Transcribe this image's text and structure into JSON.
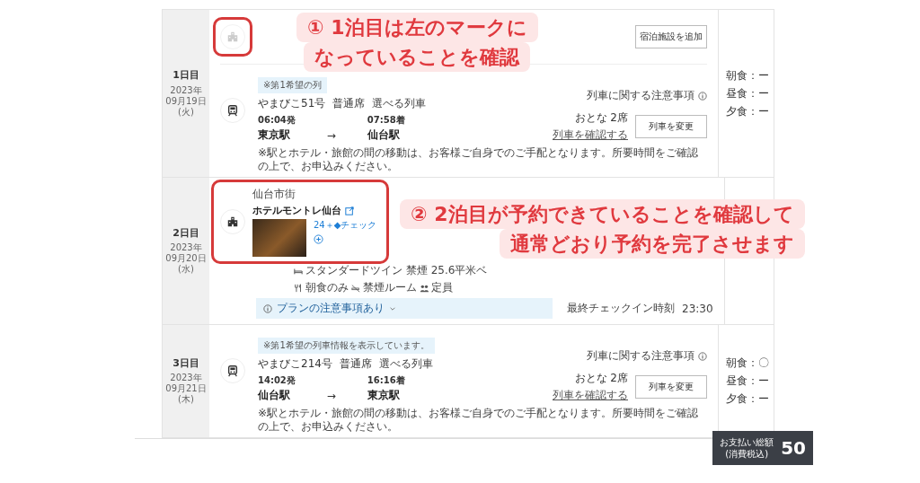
{
  "days": [
    {
      "label": "1日目",
      "year": "2023年",
      "date": "09月19日",
      "weekday": "(火)",
      "stay": {
        "booked": false,
        "button": "宿泊施設を追加",
        "highlighted": true
      },
      "train": {
        "notice": "※第1希望の列",
        "name": "やまびこ51号",
        "seat": "普通席",
        "tag": "選べる列車",
        "dep_time": "06:04発",
        "arr_time": "07:58着",
        "from": "東京駅",
        "arrow": "→",
        "to": "仙台駅",
        "note": "※駅とホテル・旅館の間の移動は、お客様ご自身でのご手配となります。所要時間をご確認の上で、お申込みください。",
        "caution": "列車に関する注意事項",
        "seats": "おとな 2席",
        "check_link": "列車を確認する",
        "change_button": "列車を変更"
      },
      "meals": [
        "朝食：ー",
        "昼食：ー",
        "夕食：ー"
      ]
    },
    {
      "label": "2日目",
      "year": "2023年",
      "date": "09月20日",
      "weekday": "(水)",
      "stay": {
        "booked": true,
        "highlighted": true,
        "area": "仙台市街",
        "name": "ホテルモントレ仙台",
        "plan": "24＋◆チェック",
        "room": "スタンダードツイン 禁煙 25.6平米ベ",
        "meal": "朝食のみ",
        "smoking": "禁煙ルーム",
        "capacity": "定員",
        "plan_notice": "プランの注意事項あり",
        "checkin_label": "最終チェックイン時刻",
        "checkin_time": "23:30"
      }
    },
    {
      "label": "3日目",
      "year": "2023年",
      "date": "09月21日",
      "weekday": "(木)",
      "train": {
        "notice": "※第1希望の列車情報を表示しています。",
        "name": "やまびこ214号",
        "seat": "普通席",
        "tag": "選べる列車",
        "dep_time": "14:02発",
        "arr_time": "16:16着",
        "from": "仙台駅",
        "arrow": "→",
        "to": "東京駅",
        "note": "※駅とホテル・旅館の間の移動は、お客様ご自身でのご手配となります。所要時間をご確認の上で、お申込みください。",
        "caution": "列車に関する注意事項",
        "seats": "おとな 2席",
        "check_link": "列車を確認する",
        "change_button": "列車を変更"
      },
      "meals": [
        "朝食：〇",
        "昼食：ー",
        "夕食：ー"
      ]
    }
  ],
  "payment": {
    "label": "お支払い総額",
    "tax_note": "(消費税込)",
    "amount": "50"
  },
  "callouts": [
    {
      "lines": [
        "① 1泊目は左のマークに",
        "なっていることを確認"
      ]
    },
    {
      "lines": [
        "② 2泊目が予約できていることを確認して",
        "通常どおり予約を完了させます"
      ]
    }
  ]
}
